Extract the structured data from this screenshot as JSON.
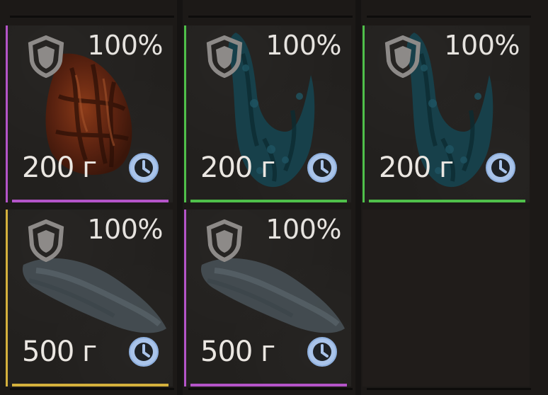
{
  "inventory": {
    "slots": [
      {
        "quality": "100%",
        "weight": "200 г",
        "rarity_color": "#b454c8",
        "item_icon": "mushroom-morel-icon"
      },
      {
        "quality": "100%",
        "weight": "200 г",
        "rarity_color": "#4fbf4a",
        "item_icon": "blue-herb-icon"
      },
      {
        "quality": "100%",
        "weight": "200 г",
        "rarity_color": "#4fbf4a",
        "item_icon": "blue-herb-icon"
      },
      {
        "quality": "100%",
        "weight": "500 г",
        "rarity_color": "#d4b03c",
        "item_icon": "grey-fish-icon"
      },
      {
        "quality": "100%",
        "weight": "500 г",
        "rarity_color": "#b454c8",
        "item_icon": "grey-fish-icon"
      }
    ],
    "empty_slots": 1
  },
  "icons": {
    "shield": "shield-icon",
    "clock": "clock-icon"
  }
}
